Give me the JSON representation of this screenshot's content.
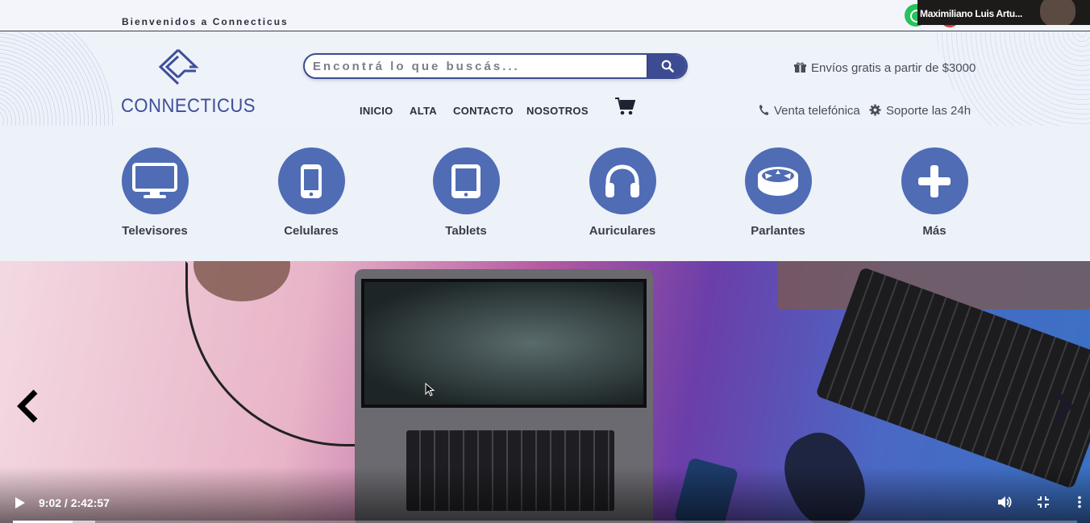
{
  "topbar": {
    "welcome": "Bienvenidos a Connecticus"
  },
  "call": {
    "participant_name": "Maximiliano Luis Artu..."
  },
  "brand": {
    "name": "CONNECTICUS",
    "color": "#3e4f9a"
  },
  "search": {
    "placeholder": "Encontrá lo que buscás...",
    "value": ""
  },
  "nav": {
    "items": [
      "INICIO",
      "ALTA",
      "CONTACTO",
      "NOSOTROS"
    ]
  },
  "info": {
    "shipping": "Envíos gratis a partir de $3000",
    "phone": "Venta telefónica",
    "support": "Soporte las 24h"
  },
  "categories": [
    {
      "label": "Televisores",
      "icon": "tv-icon"
    },
    {
      "label": "Celulares",
      "icon": "mobile-icon"
    },
    {
      "label": "Tablets",
      "icon": "tablet-icon"
    },
    {
      "label": "Auriculares",
      "icon": "headphones-icon"
    },
    {
      "label": "Parlantes",
      "icon": "speaker-icon"
    },
    {
      "label": "Más",
      "icon": "plus-icon"
    }
  ],
  "video": {
    "time": "9:02 / 2:42:57",
    "progress": 0.056
  },
  "colors": {
    "accent": "#4f6cb5",
    "dark_blue": "#3c4b92"
  }
}
